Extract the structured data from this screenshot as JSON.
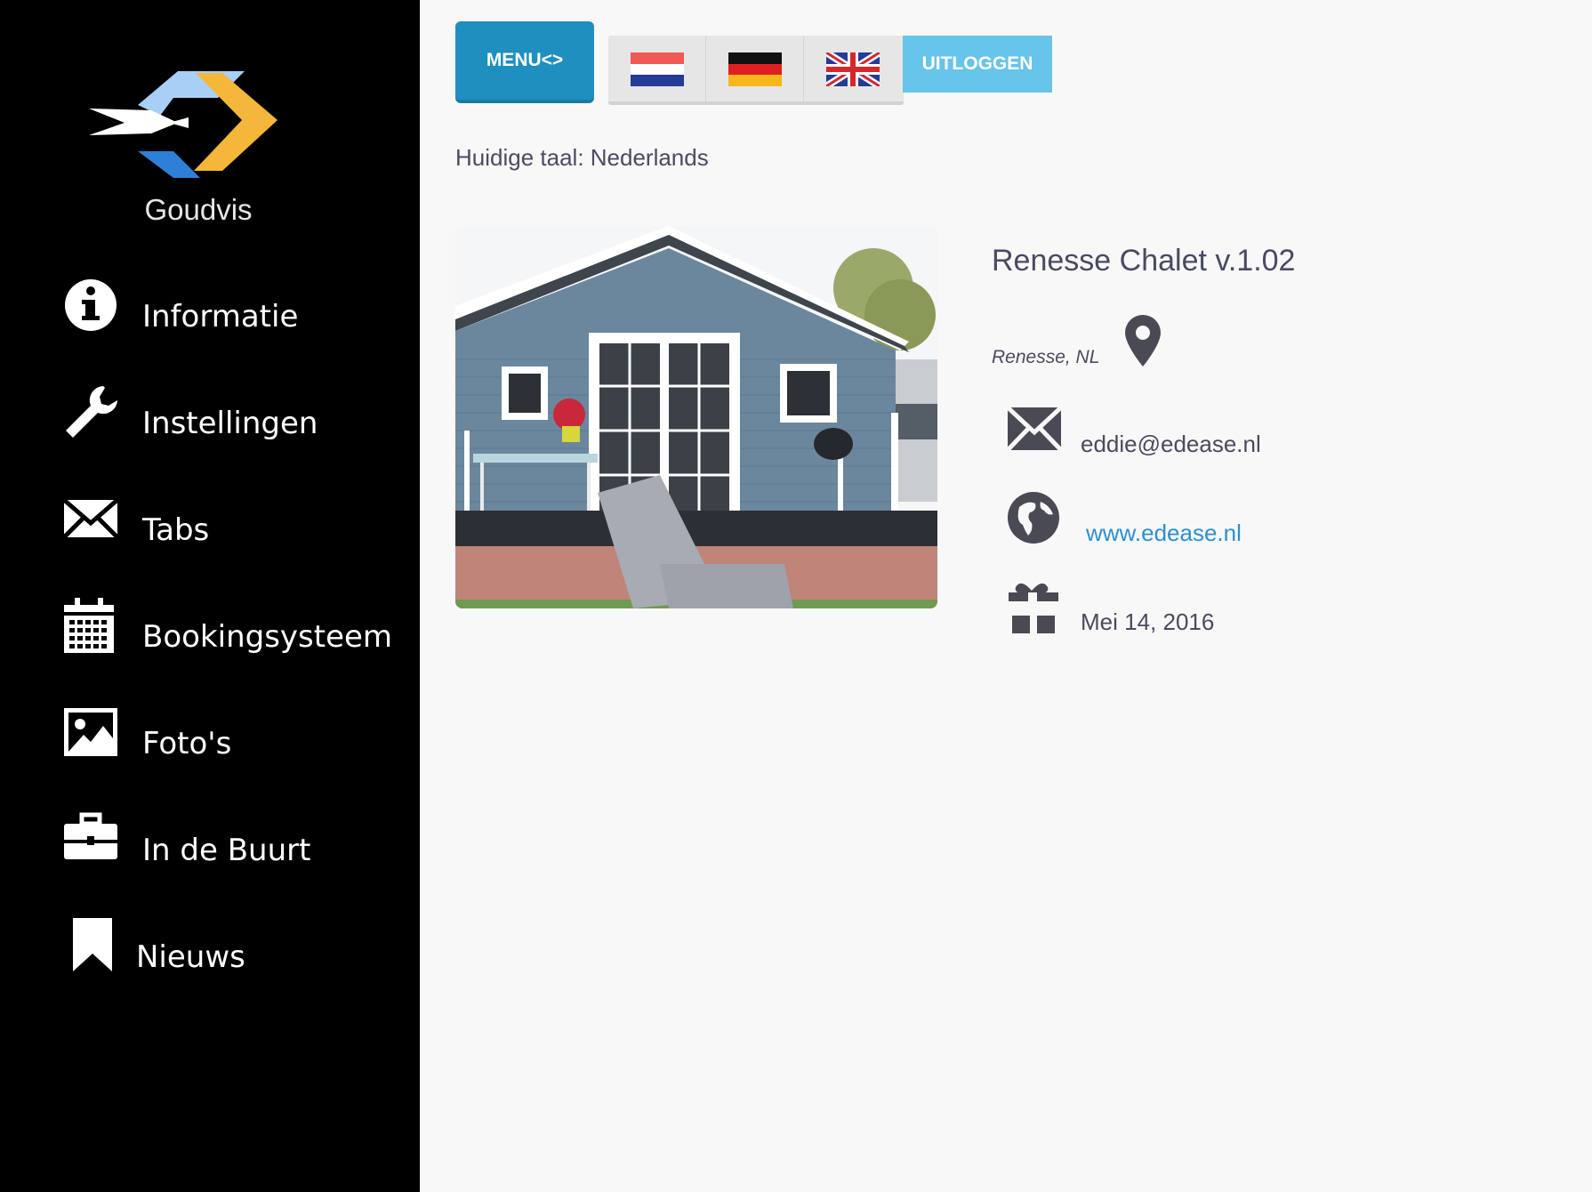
{
  "logo": {
    "name": "Goudvis"
  },
  "sidebar": {
    "items": [
      {
        "label": "Informatie",
        "icon": "info-circle-icon"
      },
      {
        "label": "Instellingen",
        "icon": "wrench-icon"
      },
      {
        "label": "Tabs",
        "icon": "envelope-icon"
      },
      {
        "label": "Bookingsysteem",
        "icon": "calendar-icon"
      },
      {
        "label": "Foto's",
        "icon": "image-icon"
      },
      {
        "label": "In de Buurt",
        "icon": "briefcase-icon"
      },
      {
        "label": "Nieuws",
        "icon": "bookmark-icon"
      }
    ]
  },
  "toolbar": {
    "menu_label": "MENU<>",
    "languages": [
      {
        "name": "Nederlands",
        "flag": "flag-nl-icon"
      },
      {
        "name": "Deutsch",
        "flag": "flag-de-icon"
      },
      {
        "name": "English",
        "flag": "flag-gb-icon"
      }
    ],
    "logout_label": "UITLOGGEN",
    "current_language": "Huidige taal: Nederlands"
  },
  "property": {
    "title": "Renesse Chalet v.1.02",
    "location": "Renesse, NL",
    "email": "eddie@edease.nl",
    "website": "www.edease.nl",
    "date": "Mei 14, 2016"
  },
  "colors": {
    "sidebar_bg": "#000000",
    "menu_button": "#1f8fc0",
    "logout_button": "#67c4ea",
    "link": "#2d8fd0",
    "icon": "#4a4a55"
  }
}
